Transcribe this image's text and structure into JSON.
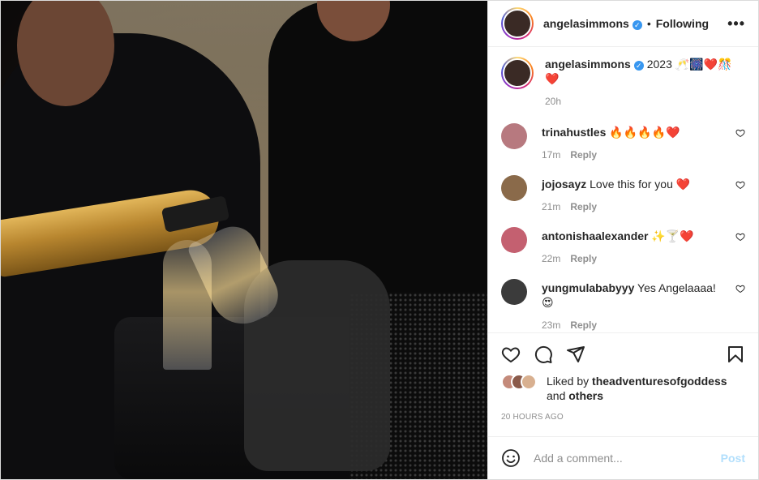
{
  "header": {
    "username": "angelasimmons",
    "verified_mark": "✓",
    "separator": "•",
    "follow_status": "Following",
    "more_label": "•••"
  },
  "caption": {
    "username": "angelasimmons",
    "text": "2023 🥂🎆❤️🎊❤️",
    "age": "20h"
  },
  "comments": [
    {
      "username": "trinahustles",
      "text": "🔥🔥🔥🔥❤️",
      "age": "17m",
      "reply_label": "Reply",
      "avatar_color": "#b7797f"
    },
    {
      "username": "jojosayz",
      "text": "Love this for you ❤️",
      "age": "21m",
      "reply_label": "Reply",
      "avatar_color": "#8a6a4a"
    },
    {
      "username": "antonishaalexander",
      "text": "✨🍸❤️",
      "age": "22m",
      "reply_label": "Reply",
      "avatar_color": "#c46070"
    },
    {
      "username": "yungmulababyyy",
      "text": "Yes Angelaaaa! 😍",
      "age": "23m",
      "reply_label": "Reply",
      "avatar_color": "#3b3b3b"
    }
  ],
  "likes": {
    "prefix": "Liked by",
    "top_liker": "theadventuresofgoddess",
    "conjunction": "and",
    "others_label": "others"
  },
  "timestamp": "20 hours ago",
  "composer": {
    "placeholder": "Add a comment...",
    "post_label": "Post"
  },
  "icons": {
    "like": "heart-icon",
    "comment": "comment-icon",
    "share": "paper-plane-icon",
    "save": "bookmark-icon",
    "emoji": "smiley-icon"
  },
  "colors": {
    "verified": "#3897f0",
    "post_button": "#b2dffc",
    "muted_text": "#8e8e8e"
  }
}
